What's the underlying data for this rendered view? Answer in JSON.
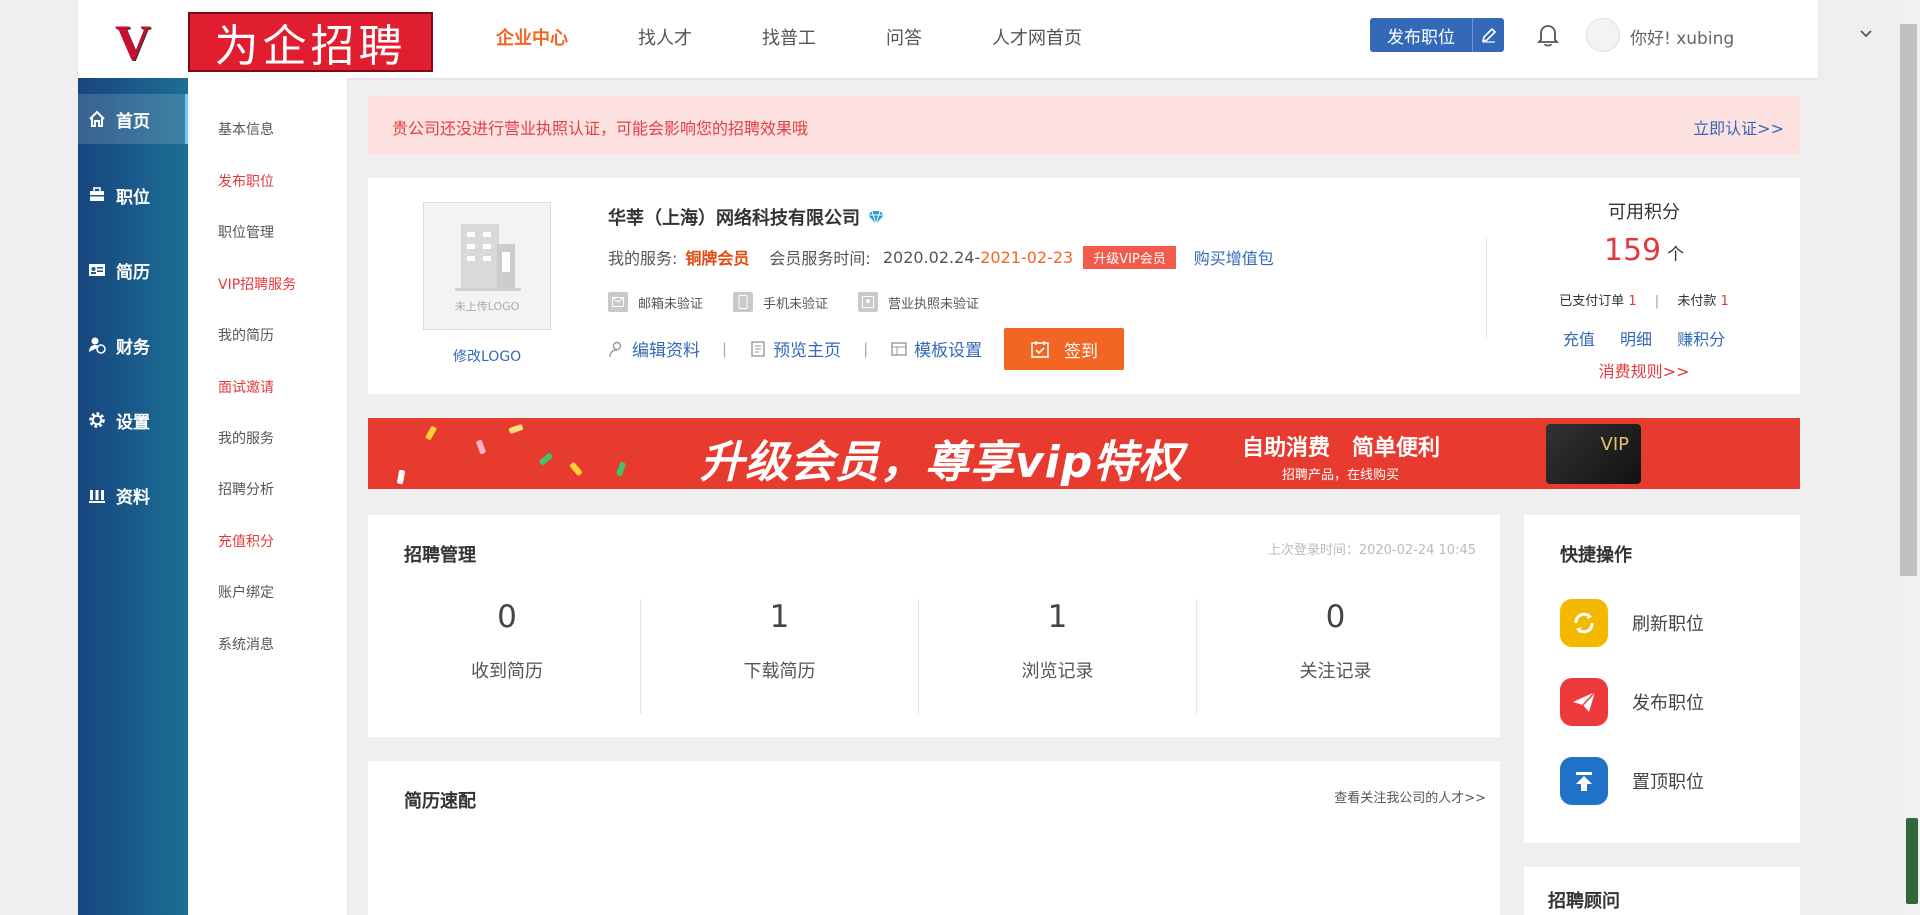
{
  "header": {
    "logo_letter": "V",
    "logo_text": "为企招聘",
    "nav": [
      "企业中心",
      "找人才",
      "找普工",
      "问答",
      "人才网首页"
    ],
    "nav_active_index": 0,
    "post_job_label": "发布职位",
    "greeting": "你好! xubing"
  },
  "rail": {
    "items": [
      "首页",
      "职位",
      "简历",
      "财务",
      "设置",
      "资料"
    ],
    "active_index": 0
  },
  "subnav": {
    "items": [
      {
        "label": "基本信息",
        "highlight": false
      },
      {
        "label": "发布职位",
        "highlight": true
      },
      {
        "label": "职位管理",
        "highlight": false
      },
      {
        "label": "VIP招聘服务",
        "highlight": true
      },
      {
        "label": "我的简历",
        "highlight": false
      },
      {
        "label": "面试邀请",
        "highlight": true
      },
      {
        "label": "我的服务",
        "highlight": false
      },
      {
        "label": "招聘分析",
        "highlight": false
      },
      {
        "label": "充值积分",
        "highlight": true
      },
      {
        "label": "账户绑定",
        "highlight": false
      },
      {
        "label": "系统消息",
        "highlight": false
      }
    ]
  },
  "alert": {
    "message": "贵公司还没进行营业执照认证，可能会影响您的招聘效果哦",
    "action": "立即认证>>"
  },
  "company": {
    "logo_placeholder": "未上传LOGO",
    "edit_logo": "修改LOGO",
    "name": "华莘（上海）网络科技有限公司",
    "service_label": "我的服务:",
    "service_tier": "铜牌会员",
    "period_label": "会员服务时间:",
    "period_start": "2020.02.24-",
    "period_end": "2021-02-23",
    "upgrade_vip": "升级VIP会员",
    "buy_package": "购买增值包",
    "verifications": [
      "邮箱未验证",
      "手机未验证",
      "营业执照未验证"
    ],
    "links": [
      "编辑资料",
      "预览主页",
      "模板设置"
    ],
    "link_sep": "|",
    "signin": "签到"
  },
  "points": {
    "title": "可用积分",
    "value": "159",
    "unit": "个",
    "paid_label": "已支付订单",
    "paid_count": "1",
    "unpaid_label": "未付款",
    "unpaid_count": "1",
    "sep": "|",
    "actions": [
      "充值",
      "明细",
      "赚积分"
    ],
    "rules": "消费规则>>"
  },
  "banner": {
    "headline": "升级会员，尊享vip特权",
    "slogan": "自助消费　简单便利",
    "sub": "招聘产品，在线购买",
    "card_label": "VIP"
  },
  "recruit": {
    "title": "招聘管理",
    "last_login": "上次登录时间：2020-02-24 10:45",
    "stats": [
      {
        "value": "0",
        "label": "收到简历"
      },
      {
        "value": "1",
        "label": "下载简历"
      },
      {
        "value": "1",
        "label": "浏览记录"
      },
      {
        "value": "0",
        "label": "关注记录"
      }
    ]
  },
  "quick": {
    "title": "快捷操作",
    "items": [
      {
        "label": "刷新职位",
        "icon": "refresh-icon",
        "color": "#f5b800"
      },
      {
        "label": "发布职位",
        "icon": "paper-plane-icon",
        "color": "#ee3a3a"
      },
      {
        "label": "置顶职位",
        "icon": "pin-top-icon",
        "color": "#1e73c9"
      }
    ]
  },
  "match": {
    "title": "简历速配",
    "more": "查看关注我公司的人才>>"
  },
  "advisor": {
    "title": "招聘顾问"
  },
  "colors": {
    "accent": "#f26522",
    "brand_blue": "#3469b7",
    "alert_red": "#e14040",
    "rail_from": "#17457f",
    "rail_to": "#1c6f94"
  }
}
